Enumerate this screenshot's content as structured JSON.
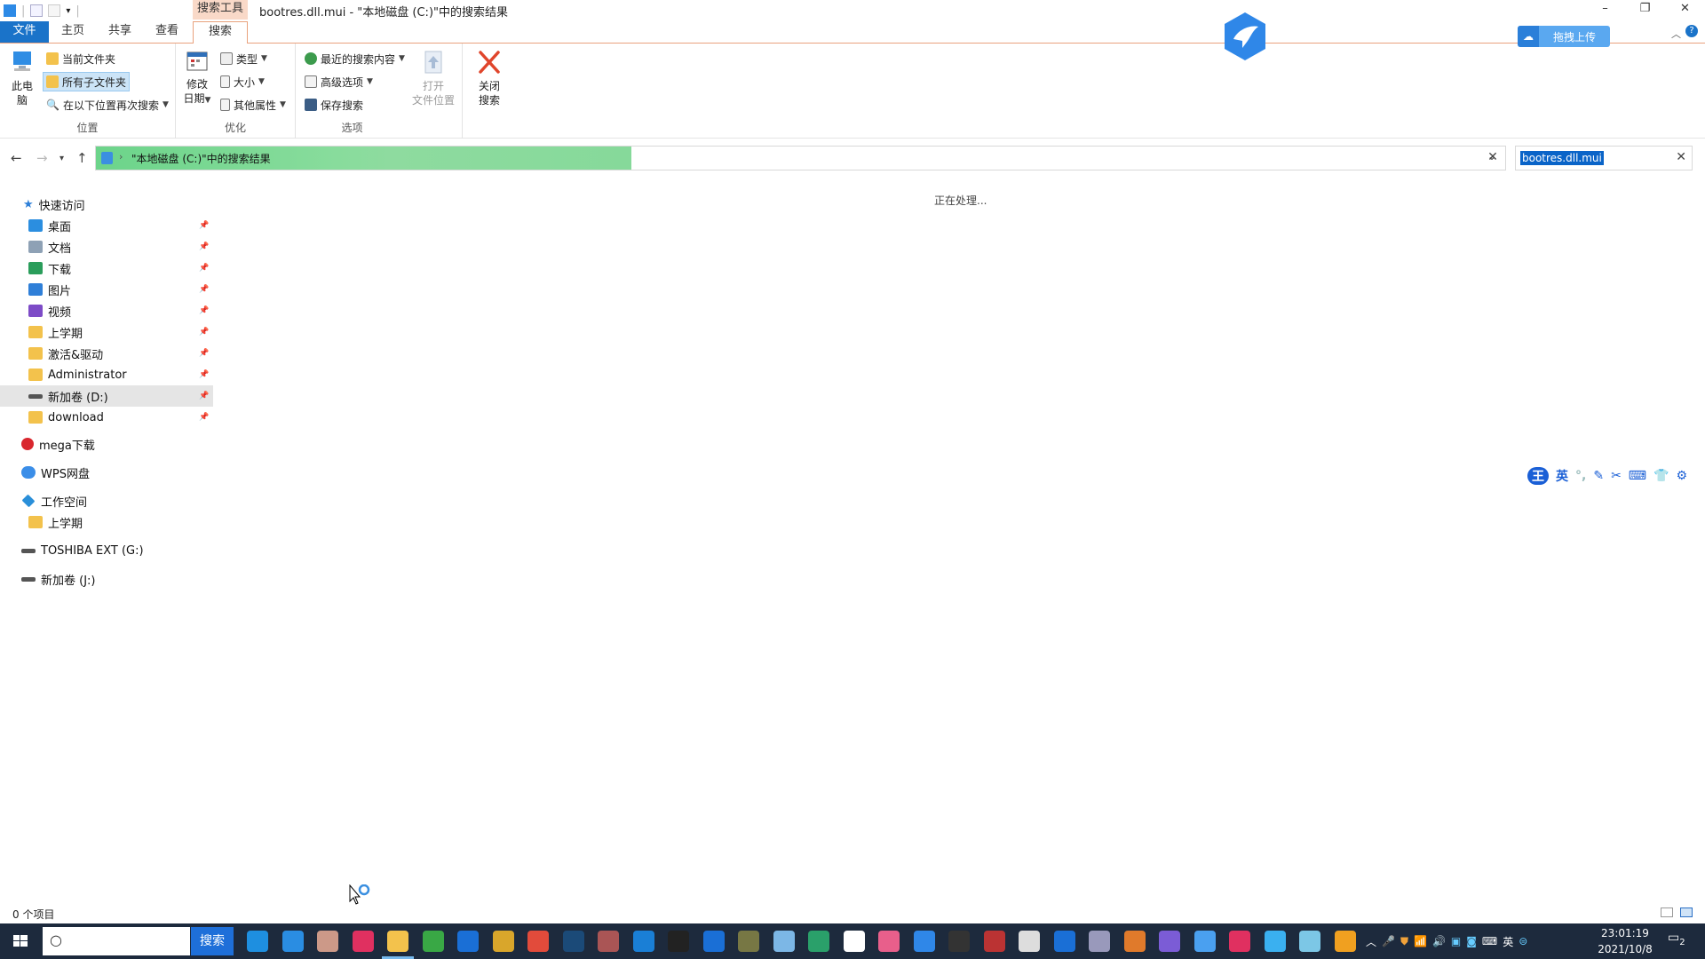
{
  "window": {
    "title": "bootres.dll.mui - \"本地磁盘 (C:)\"中的搜索结果",
    "context_tab": "搜索工具",
    "controls": {
      "minimize": "–",
      "restore": "❐",
      "close": "✕"
    }
  },
  "ribbon_tabs": [
    "文件",
    "主页",
    "共享",
    "查看",
    "搜索"
  ],
  "ribbon": {
    "location": {
      "label": "位置",
      "this_pc": "此电\n脑",
      "this_pc_l1": "此电",
      "this_pc_l2": "脑",
      "current_folder": "当前文件夹",
      "all_subfolders": "所有子文件夹",
      "search_again_in": "在以下位置再次搜索"
    },
    "refine": {
      "label": "优化",
      "date_modified_l1": "修改",
      "date_modified_l2": "日期",
      "kind": "类型",
      "size": "大小",
      "other_props": "其他属性"
    },
    "options": {
      "label": "选项",
      "recent_searches": "最近的搜索内容",
      "advanced": "高级选项",
      "save_search": "保存搜索",
      "open_location_l1": "打开",
      "open_location_l2": "文件位置",
      "close_search_l1": "关闭",
      "close_search_l2": "搜索"
    }
  },
  "address": {
    "path": "\"本地磁盘 (C:)\"中的搜索结果",
    "progress": 0.38,
    "search_value": "bootres.dll.mui"
  },
  "sidebar": {
    "quick_access": "快速访问",
    "pinned": [
      {
        "label": "桌面",
        "icon": "desktop-icon"
      },
      {
        "label": "文档",
        "icon": "documents-icon"
      },
      {
        "label": "下载",
        "icon": "download-arrow-icon"
      },
      {
        "label": "图片",
        "icon": "pictures-icon"
      },
      {
        "label": "视频",
        "icon": "videos-icon"
      },
      {
        "label": "上学期",
        "icon": "folder-sync-icon"
      },
      {
        "label": "激活&驱动",
        "icon": "folder-icon"
      },
      {
        "label": "Administrator",
        "icon": "folder-icon"
      },
      {
        "label": "新加卷 (D:)",
        "icon": "drive-icon"
      },
      {
        "label": "download",
        "icon": "folder-icon"
      }
    ],
    "mega": "mega下载",
    "wps": "WPS网盘",
    "workspace": "工作空间",
    "workspace_child": "上学期",
    "toshiba": "TOSHIBA EXT (G:)",
    "drive_j": "新加卷 (J:)"
  },
  "content": {
    "processing": "正在处理..."
  },
  "status": {
    "item_count": "0 个项目"
  },
  "cloud_upload": "拖拽上传",
  "ime": [
    "王",
    "英",
    "°,",
    "✎",
    "✂",
    "⌨",
    "👕",
    "⚙"
  ],
  "taskbar": {
    "search_button": "搜索",
    "tray_ime": "英",
    "time": "23:01:19",
    "date": "2021/10/8",
    "notif_count": "2"
  },
  "colors": {
    "file_tab": "#1a73c9",
    "context_tab": "#f9d9c8",
    "progress": "#7fd894",
    "selection": "#0a64c8",
    "taskbar": "#1d2a3d"
  }
}
